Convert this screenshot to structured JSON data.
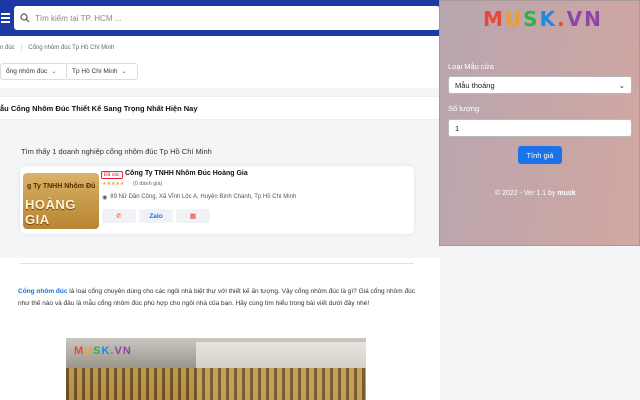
{
  "search": {
    "placeholder": "Tìm kiếm tại TP. HCM ..."
  },
  "breadcrumb": [
    "n đúc",
    "Cổng nhôm đúc Tp Hồ Chí Minh"
  ],
  "filters": [
    "ổng nhôm đúc",
    "Tp Hồ Chí Minh"
  ],
  "page_title": "ẫu Cổng Nhôm Đúc Thiết Kế Sang Trọng Nhất Hiện Nay",
  "results_text": "Tìm thấy 1 doanh nghiệp cổng nhôm đúc Tp Hồ Chí Minh",
  "listing": {
    "image_text_top": "g Ty TNHH Nhôm Đú",
    "image_text_big": "HOÀNG GIA",
    "verified": "Đã xác",
    "company": "Công Ty TNHH Nhôm Đúc Hoàng Gia",
    "stars": "★★★★★",
    "rating": "(0 đánh giá)",
    "address_icon": "pin-icon",
    "address": "89 Nữ Dân Công, Xã Vĩnh Lộc A, Huyện Bình Chánh, Tp Hồ Chí Minh",
    "actions": {
      "phone_icon": "phone-icon",
      "zalo": "Zalo",
      "map_icon": "map-icon"
    }
  },
  "article": {
    "link_text": "Cổng nhôm đúc",
    "body": " là loại cổng chuyên dùng cho các ngôi nhà biệt thự với thiết kế ấn tượng. Vậy cổng nhôm đúc là gì? Giá cổng nhôm đúc như thế nào và đâu là mẫu cổng nhôm đúc phù hợp cho ngôi nhà của bạn. Hãy cùng tìm hiểu trong bài viết dưới đây nhé!",
    "photo_logo": "MUSK.VN"
  },
  "popup": {
    "brand": [
      "M",
      "U",
      "S",
      "K",
      ".",
      "VN"
    ],
    "door_type_label": "Loại Mẫu cửa",
    "door_type_value": "Mẫu thoáng",
    "quantity_label": "Số lượng",
    "quantity_value": "1",
    "price_button": "Tính giá",
    "footer_prefix": "© 2022 - Ver 1.1 by ",
    "footer_author": "musk"
  },
  "colors": {
    "topbar": "#1b3aa6",
    "accent": "#1a73e8"
  }
}
